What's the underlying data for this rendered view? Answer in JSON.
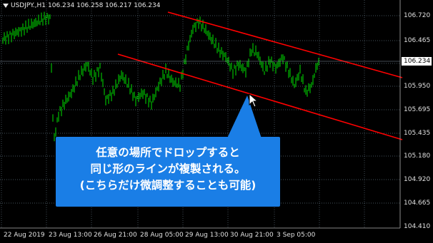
{
  "header": {
    "symbol": "USDJPY.,H1",
    "ohlc": "106.234 106.258 106.217 106.234"
  },
  "price_axis": {
    "labels": [
      "106.720",
      "106.465",
      "106.234",
      "105.950",
      "105.695",
      "105.435",
      "105.180",
      "104.920",
      "104.665",
      "104.410"
    ],
    "current_price": "106.234"
  },
  "time_axis": {
    "labels": [
      "22 Aug 2019",
      "23 Aug 13:00",
      "26 Aug 21:00",
      "28 Aug 05:00",
      "29 Aug 13:00",
      "30 Aug 21:00",
      "3 Sep 05:00"
    ]
  },
  "annotation": {
    "line1": "任意の場所でドロップすると",
    "line2": "同じ形のラインが複製される。",
    "line3": "(こちらだけ微調整することも可能)"
  },
  "colors": {
    "background": "#000000",
    "candles": "#00e000",
    "trendline": "#ff0000",
    "grid": "#5a6e7a",
    "callout": "#1a7ee6"
  },
  "icons": [
    "dropdown-triangle-icon",
    "mouse-pointer-icon"
  ]
}
